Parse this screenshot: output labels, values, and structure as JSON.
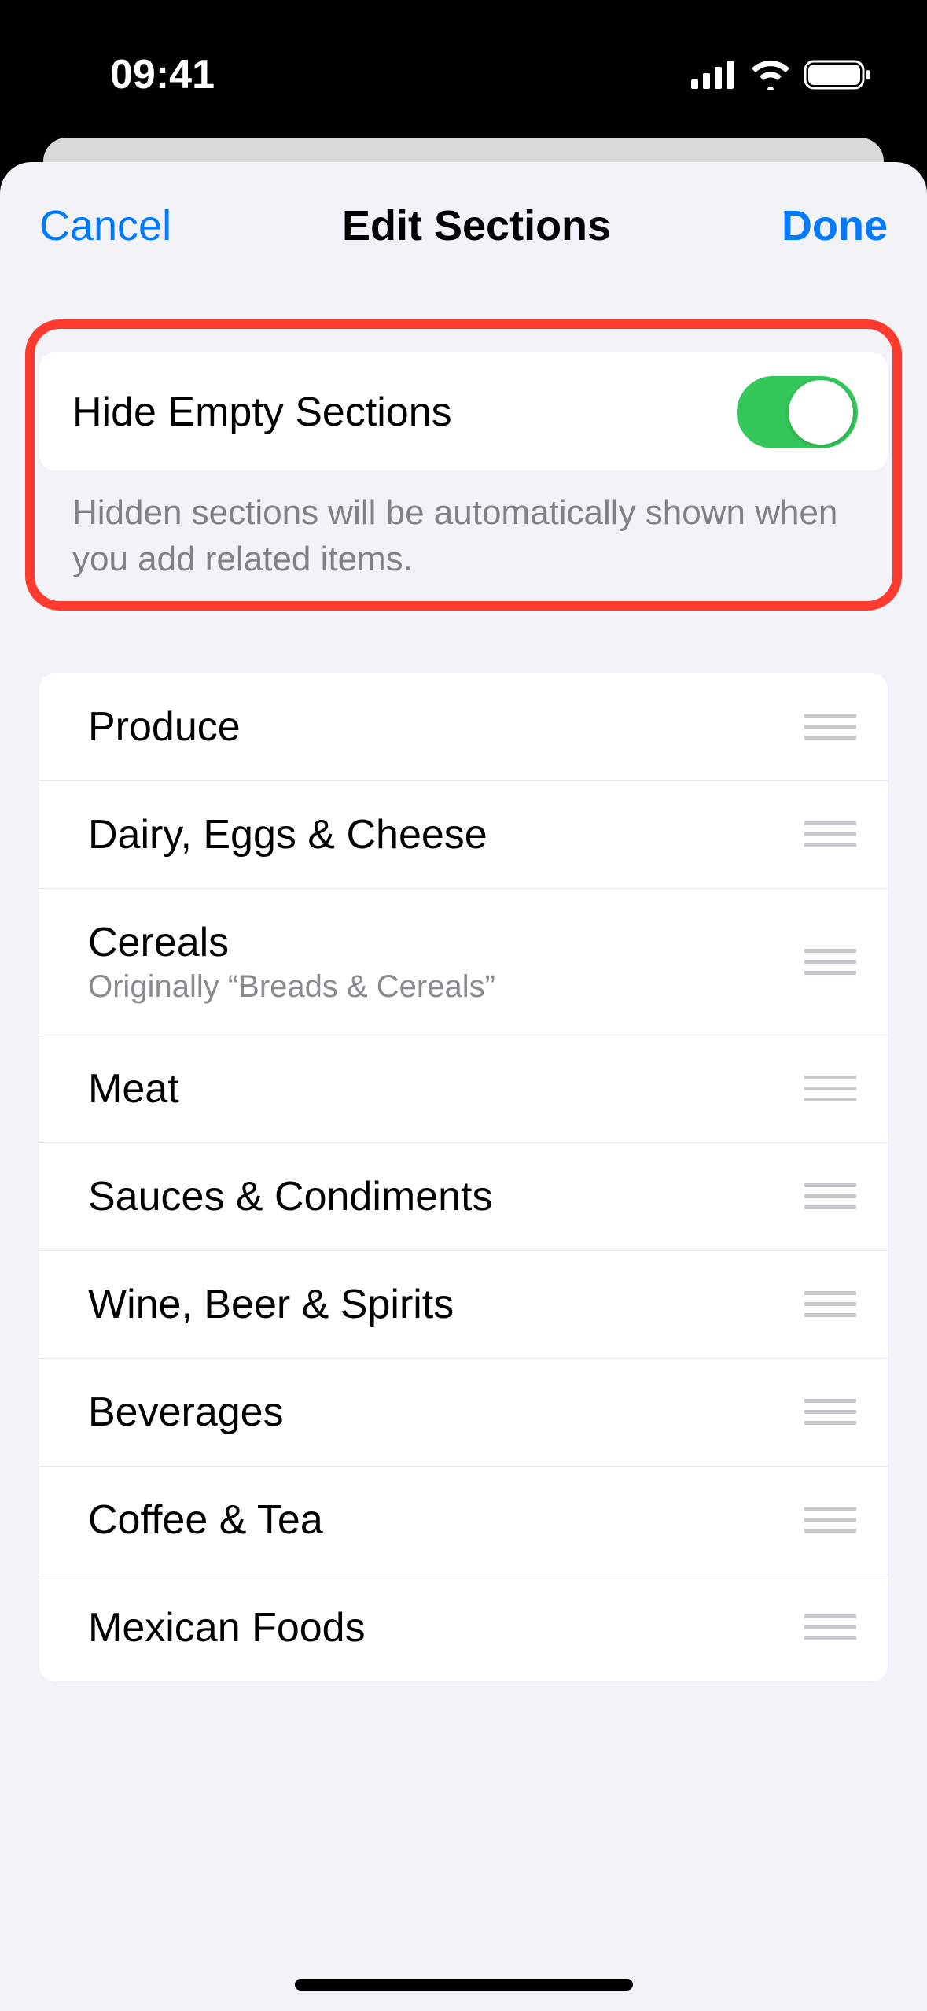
{
  "status": {
    "time": "09:41"
  },
  "nav": {
    "cancel": "Cancel",
    "title": "Edit Sections",
    "done": "Done"
  },
  "toggle": {
    "label": "Hide Empty Sections",
    "description": "Hidden sections will be automatically shown when you add related items."
  },
  "sections": [
    {
      "name": "Produce"
    },
    {
      "name": "Dairy, Eggs & Cheese"
    },
    {
      "name": "Cereals",
      "sub": "Originally “Breads & Cereals”"
    },
    {
      "name": "Meat"
    },
    {
      "name": "Sauces & Condiments"
    },
    {
      "name": "Wine, Beer & Spirits"
    },
    {
      "name": "Beverages"
    },
    {
      "name": "Coffee & Tea"
    },
    {
      "name": "Mexican Foods"
    }
  ]
}
